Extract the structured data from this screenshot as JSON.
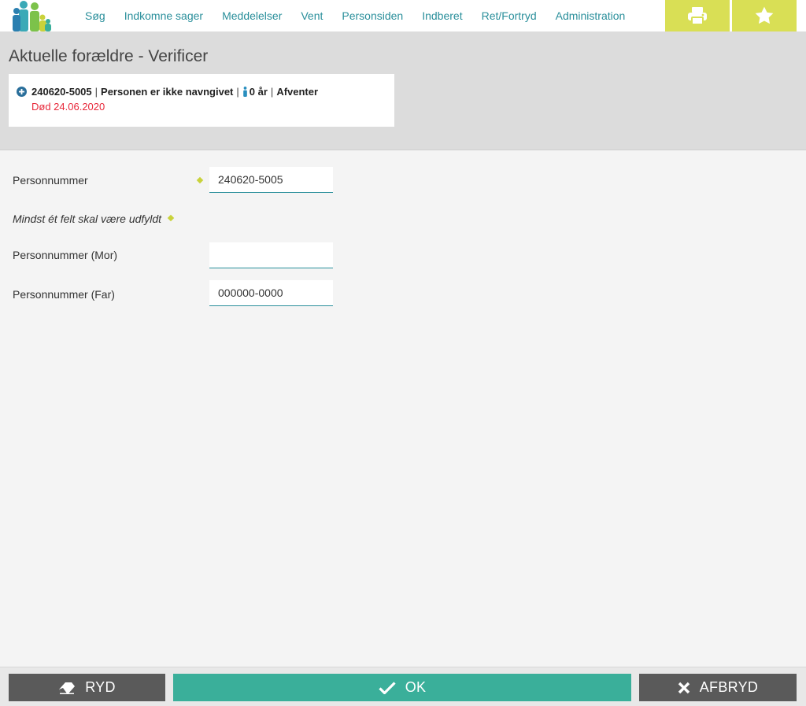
{
  "nav": {
    "items": [
      {
        "label": "Søg"
      },
      {
        "label": "Indkomne sager"
      },
      {
        "label": "Meddelelser"
      },
      {
        "label": "Vent"
      },
      {
        "label": "Personsiden"
      },
      {
        "label": "Indberet"
      },
      {
        "label": "Ret/Fortryd"
      },
      {
        "label": "Administration"
      }
    ],
    "tools": [
      "printer-icon",
      "star-icon"
    ]
  },
  "header": {
    "title": "Aktuelle forældre - Verificer",
    "person": {
      "cpr": "240620-5005",
      "name": "Personen er ikke navngivet",
      "age": "0 år",
      "status": "Afventer",
      "death": "Død 24.06.2020"
    }
  },
  "form": {
    "personnummer_label": "Personnummer",
    "personnummer_value": "240620-5005",
    "note": "Mindst ét felt skal være udfyldt",
    "mor_label": "Personnummer (Mor)",
    "mor_value": "",
    "far_label": "Personnummer (Far)",
    "far_value": "000000-0000"
  },
  "actions": {
    "ryd": "RYD",
    "ok": "OK",
    "afbryd": "AFBRYD"
  },
  "colors": {
    "accent": "#2a8f9b",
    "tool": "#d9df55",
    "ok": "#3aaf9a",
    "danger": "#e8283a"
  }
}
